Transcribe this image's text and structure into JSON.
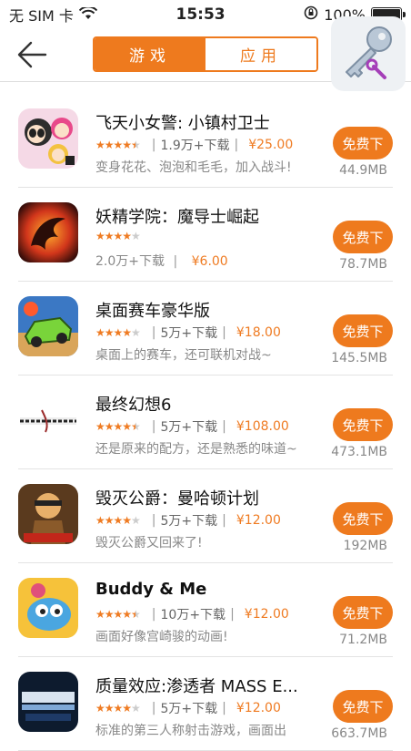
{
  "status": {
    "carrier": "无 SIM 卡",
    "time": "15:53",
    "battery": "100%",
    "battery_level": 1.0
  },
  "nav": {
    "tabs": [
      {
        "label": "游戏",
        "active": true
      },
      {
        "label": "应用",
        "active": false
      }
    ]
  },
  "apps": [
    {
      "title": "飞天小女警: 小镇村卫士",
      "rating": 4.5,
      "downloads": "1.9万+下载",
      "price": "¥25.00",
      "desc": "变身花花、泡泡和毛毛，加入战斗!",
      "button": "免费下",
      "size": "44.9MB"
    },
    {
      "title": "妖精学院：魔导士崛起",
      "rating": 4,
      "downloads": "2.0万+下载",
      "price": "¥6.00",
      "desc": "",
      "button": "免费下",
      "size": "78.7MB"
    },
    {
      "title": "桌面赛车豪华版",
      "rating": 4,
      "downloads": "5万+下载",
      "price": "¥18.00",
      "desc": "桌面上的赛车，还可联机对战~",
      "button": "免费下",
      "size": "145.5MB"
    },
    {
      "title": "最终幻想6",
      "rating": 4.5,
      "downloads": "5万+下载",
      "price": "¥108.00",
      "desc": "还是原来的配方，还是熟悉的味道~",
      "button": "免费下",
      "size": "473.1MB"
    },
    {
      "title": "毁灭公爵：曼哈顿计划",
      "rating": 4,
      "downloads": "5万+下载",
      "price": "¥12.00",
      "desc": "毁灭公爵又回来了!",
      "button": "免费下",
      "size": "192MB"
    },
    {
      "title": "Buddy & Me",
      "rating": 4.5,
      "downloads": "10万+下载",
      "price": "¥12.00",
      "desc": "画面好像宫崎骏的动画!",
      "button": "免费下",
      "size": "71.2MB"
    },
    {
      "title": "质量效应:渗透者 MASS E...",
      "rating": 4,
      "downloads": "5万+下载",
      "price": "¥12.00",
      "desc": "标准的第三人称射击游戏，画面出",
      "button": "免费下",
      "size": "663.7MB"
    }
  ],
  "colors": {
    "accent": "#ee7a1e"
  }
}
